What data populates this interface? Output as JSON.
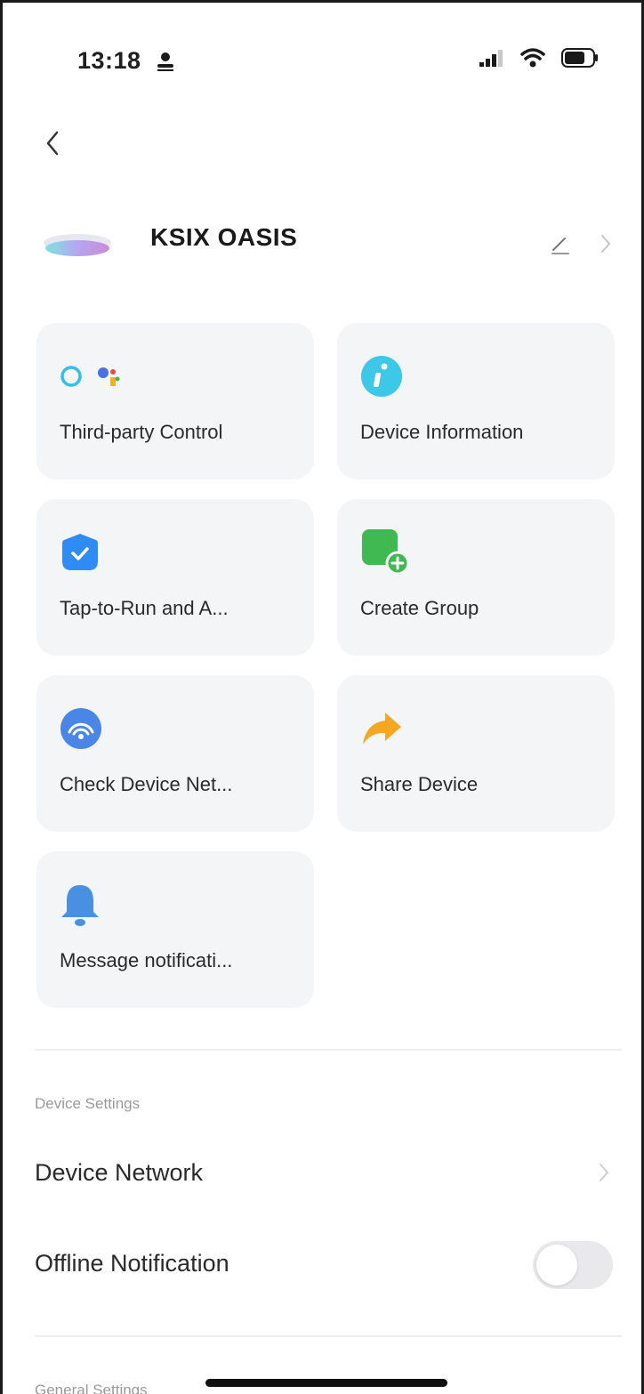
{
  "status_bar": {
    "time": "13:18"
  },
  "device": {
    "name": "KSIX OASIS"
  },
  "grid": [
    {
      "label": "Third-party Control",
      "icon": "alexa-google-icon"
    },
    {
      "label": "Device Information",
      "icon": "info-icon"
    },
    {
      "label": "Tap-to-Run and A...",
      "icon": "check-shield-icon"
    },
    {
      "label": "Create Group",
      "icon": "group-add-icon"
    },
    {
      "label": "Check Device Net...",
      "icon": "network-check-icon"
    },
    {
      "label": "Share Device",
      "icon": "share-arrow-icon"
    },
    {
      "label": "Message notificati...",
      "icon": "bell-icon"
    }
  ],
  "device_settings": {
    "title": "Device Settings",
    "rows": [
      {
        "label": "Device Network"
      },
      {
        "label": "Offline Notification",
        "toggle_on": false
      }
    ]
  },
  "general_settings": {
    "title": "General Settings"
  },
  "colors": {
    "card_bg": "#f4f5f7",
    "info_cyan": "#3cc8e6",
    "check_blue": "#2f8cf5",
    "group_green": "#3fb950",
    "network_blue": "#4a86e8",
    "share_orange": "#f5a623",
    "bell_blue": "#4a90e2"
  }
}
